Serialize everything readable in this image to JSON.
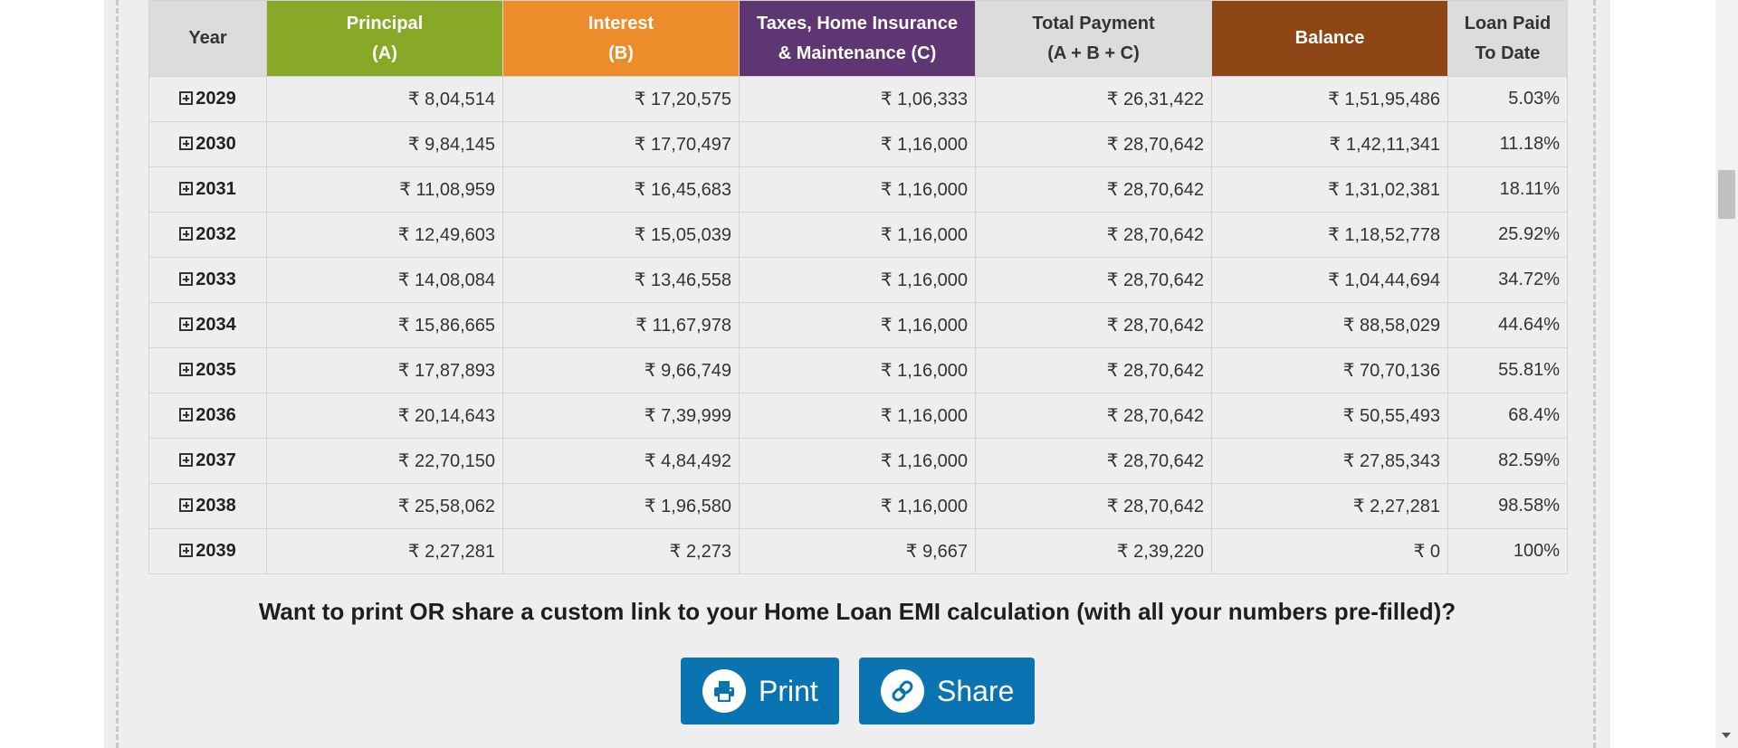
{
  "table": {
    "headers": {
      "year": "Year",
      "principal": [
        "Principal",
        "(A)"
      ],
      "interest": [
        "Interest",
        "(B)"
      ],
      "taxes": [
        "Taxes, Home Insurance",
        "& Maintenance (C)"
      ],
      "total": [
        "Total Payment",
        "(A + B + C)"
      ],
      "balance": "Balance",
      "loan_paid": [
        "Loan Paid",
        "To Date"
      ]
    },
    "header_colors": {
      "principal": "#88a928",
      "interest": "#ed8c2b",
      "taxes": "#5e3671",
      "balance": "#8e4616",
      "neutral": "#dcdcdc"
    },
    "rows": [
      {
        "year": "2029",
        "principal": "₹ 8,04,514",
        "interest": "₹ 17,20,575",
        "taxes": "₹ 1,06,333",
        "total": "₹ 26,31,422",
        "balance": "₹ 1,51,95,486",
        "paid": "5.03%"
      },
      {
        "year": "2030",
        "principal": "₹ 9,84,145",
        "interest": "₹ 17,70,497",
        "taxes": "₹ 1,16,000",
        "total": "₹ 28,70,642",
        "balance": "₹ 1,42,11,341",
        "paid": "11.18%"
      },
      {
        "year": "2031",
        "principal": "₹ 11,08,959",
        "interest": "₹ 16,45,683",
        "taxes": "₹ 1,16,000",
        "total": "₹ 28,70,642",
        "balance": "₹ 1,31,02,381",
        "paid": "18.11%"
      },
      {
        "year": "2032",
        "principal": "₹ 12,49,603",
        "interest": "₹ 15,05,039",
        "taxes": "₹ 1,16,000",
        "total": "₹ 28,70,642",
        "balance": "₹ 1,18,52,778",
        "paid": "25.92%"
      },
      {
        "year": "2033",
        "principal": "₹ 14,08,084",
        "interest": "₹ 13,46,558",
        "taxes": "₹ 1,16,000",
        "total": "₹ 28,70,642",
        "balance": "₹ 1,04,44,694",
        "paid": "34.72%"
      },
      {
        "year": "2034",
        "principal": "₹ 15,86,665",
        "interest": "₹ 11,67,978",
        "taxes": "₹ 1,16,000",
        "total": "₹ 28,70,642",
        "balance": "₹ 88,58,029",
        "paid": "44.64%"
      },
      {
        "year": "2035",
        "principal": "₹ 17,87,893",
        "interest": "₹ 9,66,749",
        "taxes": "₹ 1,16,000",
        "total": "₹ 28,70,642",
        "balance": "₹ 70,70,136",
        "paid": "55.81%"
      },
      {
        "year": "2036",
        "principal": "₹ 20,14,643",
        "interest": "₹ 7,39,999",
        "taxes": "₹ 1,16,000",
        "total": "₹ 28,70,642",
        "balance": "₹ 50,55,493",
        "paid": "68.4%"
      },
      {
        "year": "2037",
        "principal": "₹ 22,70,150",
        "interest": "₹ 4,84,492",
        "taxes": "₹ 1,16,000",
        "total": "₹ 28,70,642",
        "balance": "₹ 27,85,343",
        "paid": "82.59%"
      },
      {
        "year": "2038",
        "principal": "₹ 25,58,062",
        "interest": "₹ 1,96,580",
        "taxes": "₹ 1,16,000",
        "total": "₹ 28,70,642",
        "balance": "₹ 2,27,281",
        "paid": "98.58%"
      },
      {
        "year": "2039",
        "principal": "₹ 2,27,281",
        "interest": "₹ 2,273",
        "taxes": "₹ 9,667",
        "total": "₹ 2,39,220",
        "balance": "₹ 0",
        "paid": "100%"
      }
    ]
  },
  "cta": {
    "text": "Want to print OR share a custom link to your Home Loan EMI calculation (with all your numbers pre-filled)?"
  },
  "buttons": {
    "print": {
      "label": "Print",
      "icon": "printer-icon"
    },
    "share": {
      "label": "Share",
      "icon": "link-icon"
    },
    "color": "#0a73b2"
  }
}
